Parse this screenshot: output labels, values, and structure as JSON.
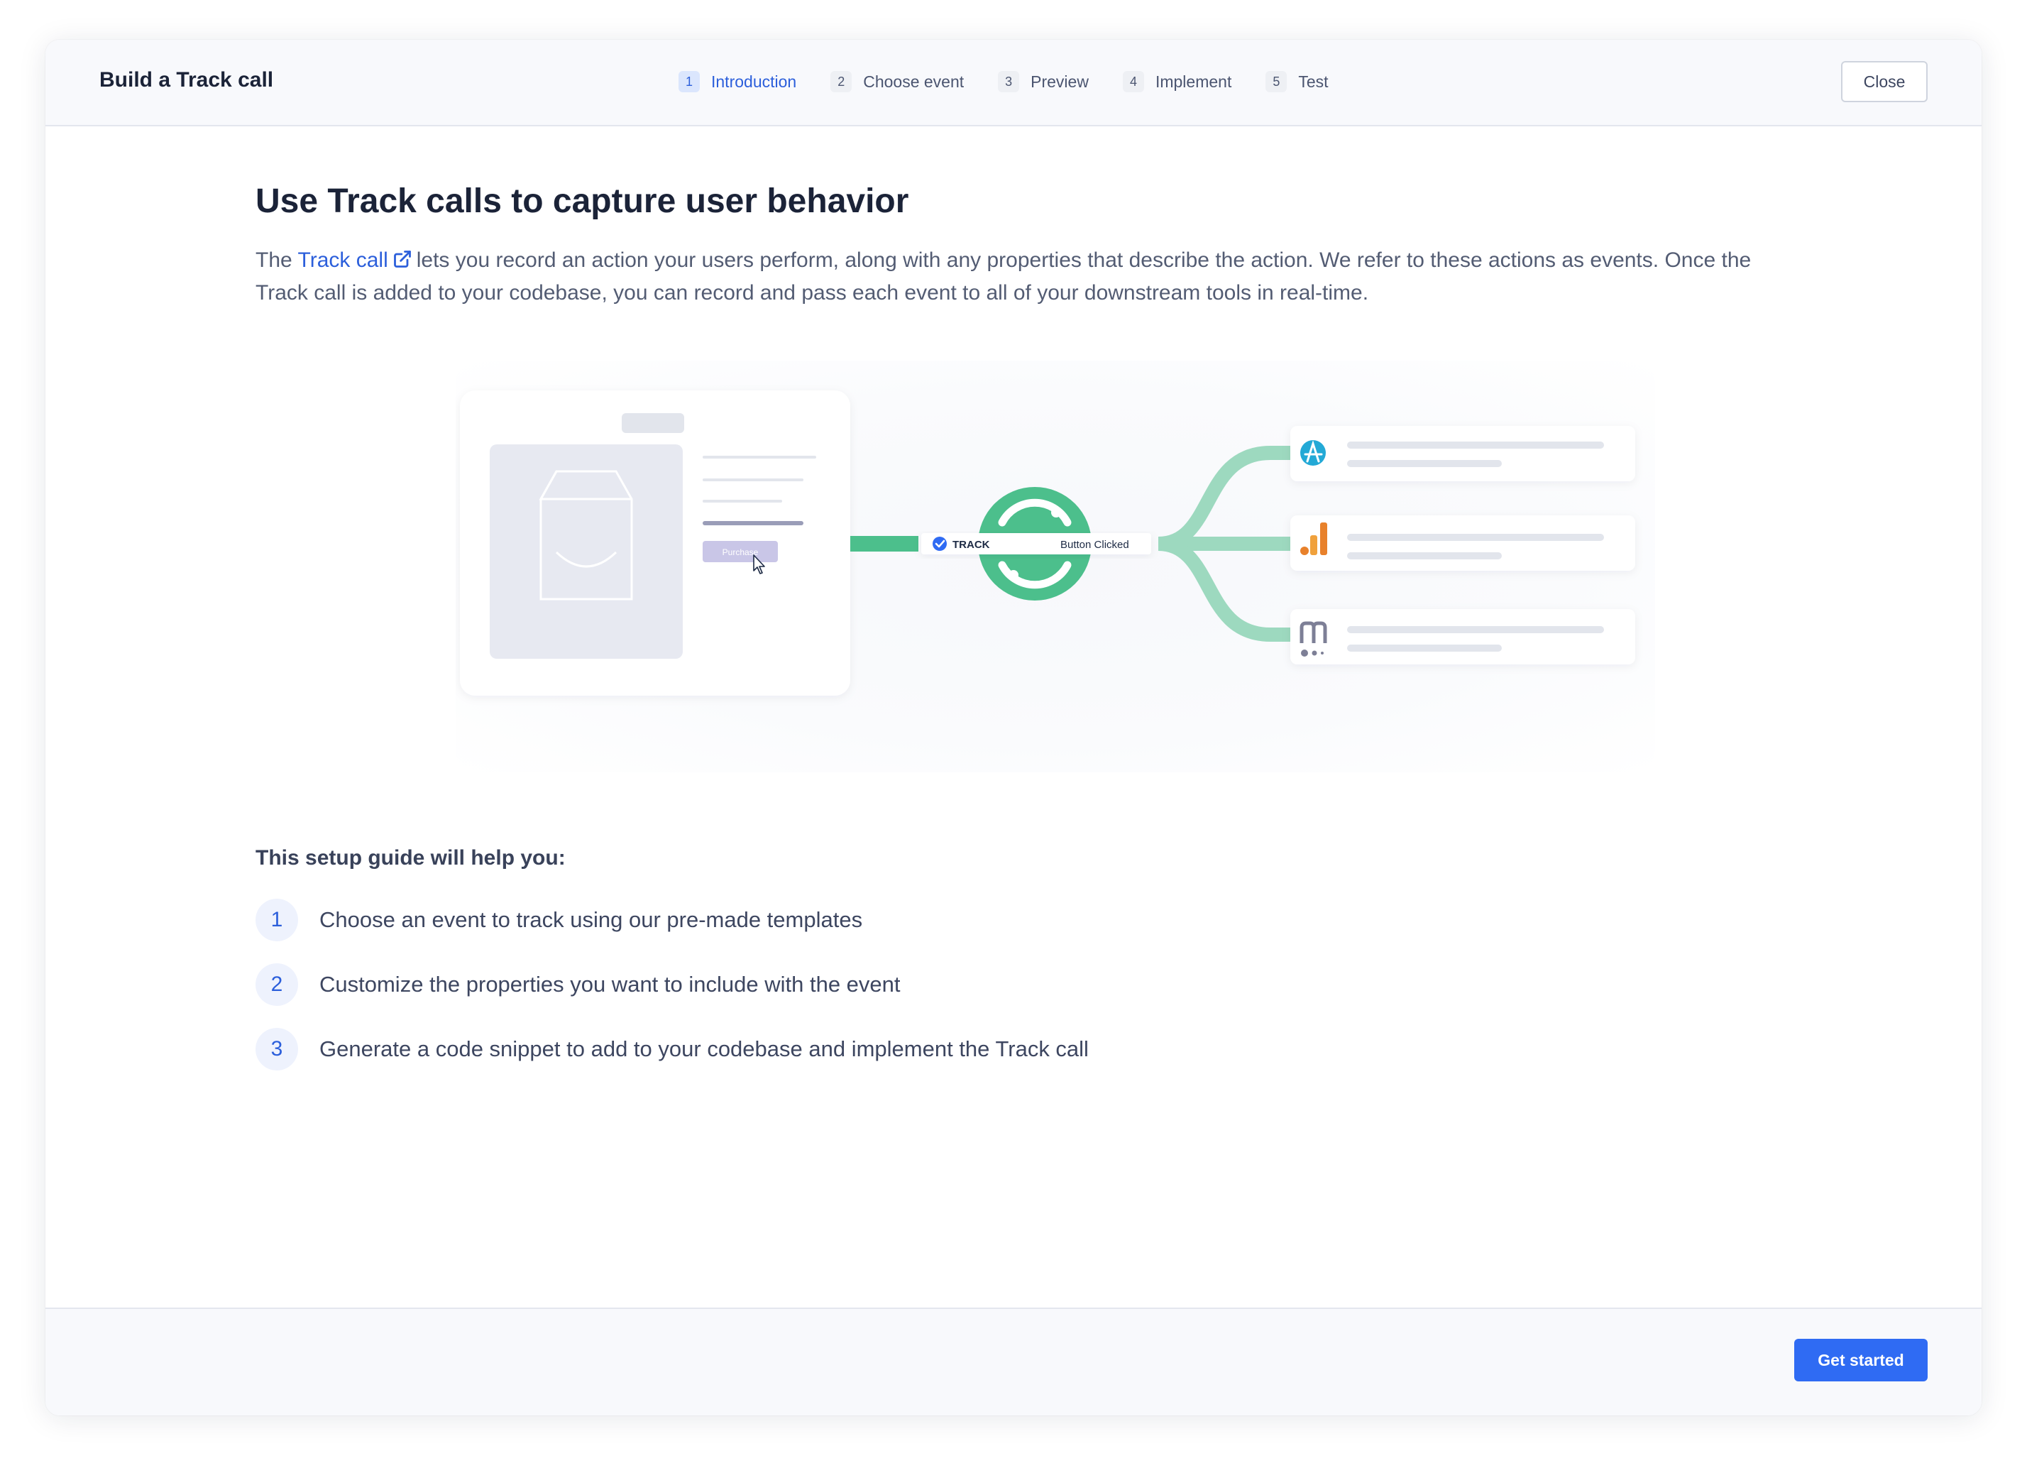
{
  "header": {
    "title": "Build a Track call",
    "steps": [
      {
        "number": "1",
        "label": "Introduction",
        "active": true
      },
      {
        "number": "2",
        "label": "Choose event",
        "active": false
      },
      {
        "number": "3",
        "label": "Preview",
        "active": false
      },
      {
        "number": "4",
        "label": "Implement",
        "active": false
      },
      {
        "number": "5",
        "label": "Test",
        "active": false
      }
    ],
    "close_label": "Close"
  },
  "main": {
    "headline": "Use Track calls to capture user behavior",
    "intro_prefix": "The ",
    "intro_link": "Track call",
    "intro_suffix": "lets you record an action your users perform, along with any properties that describe the action. We refer to these actions as events. Once the Track call is added to your codebase, you can record and pass each event to all of your downstream tools in real-time.",
    "illustration": {
      "purchase_label": "Purchase",
      "track_label": "TRACK",
      "event_label": "Button Clicked",
      "destination_icons": [
        "amplitude-icon",
        "google-analytics-icon",
        "mixpanel-icon"
      ]
    },
    "setup_title": "This setup guide will help you:",
    "guide_items": [
      {
        "number": "1",
        "text": "Choose an event to track using our pre-made templates"
      },
      {
        "number": "2",
        "text": "Customize the properties you want to include with the event"
      },
      {
        "number": "3",
        "text": "Generate a code snippet to add to your codebase and implement the Track call"
      }
    ]
  },
  "footer": {
    "primary_label": "Get started"
  },
  "colors": {
    "accent": "#2c5fdb",
    "primary_button": "#2f6bf3",
    "segment_green": "#4cbf8c",
    "flow_green": "#9dd9bf"
  }
}
